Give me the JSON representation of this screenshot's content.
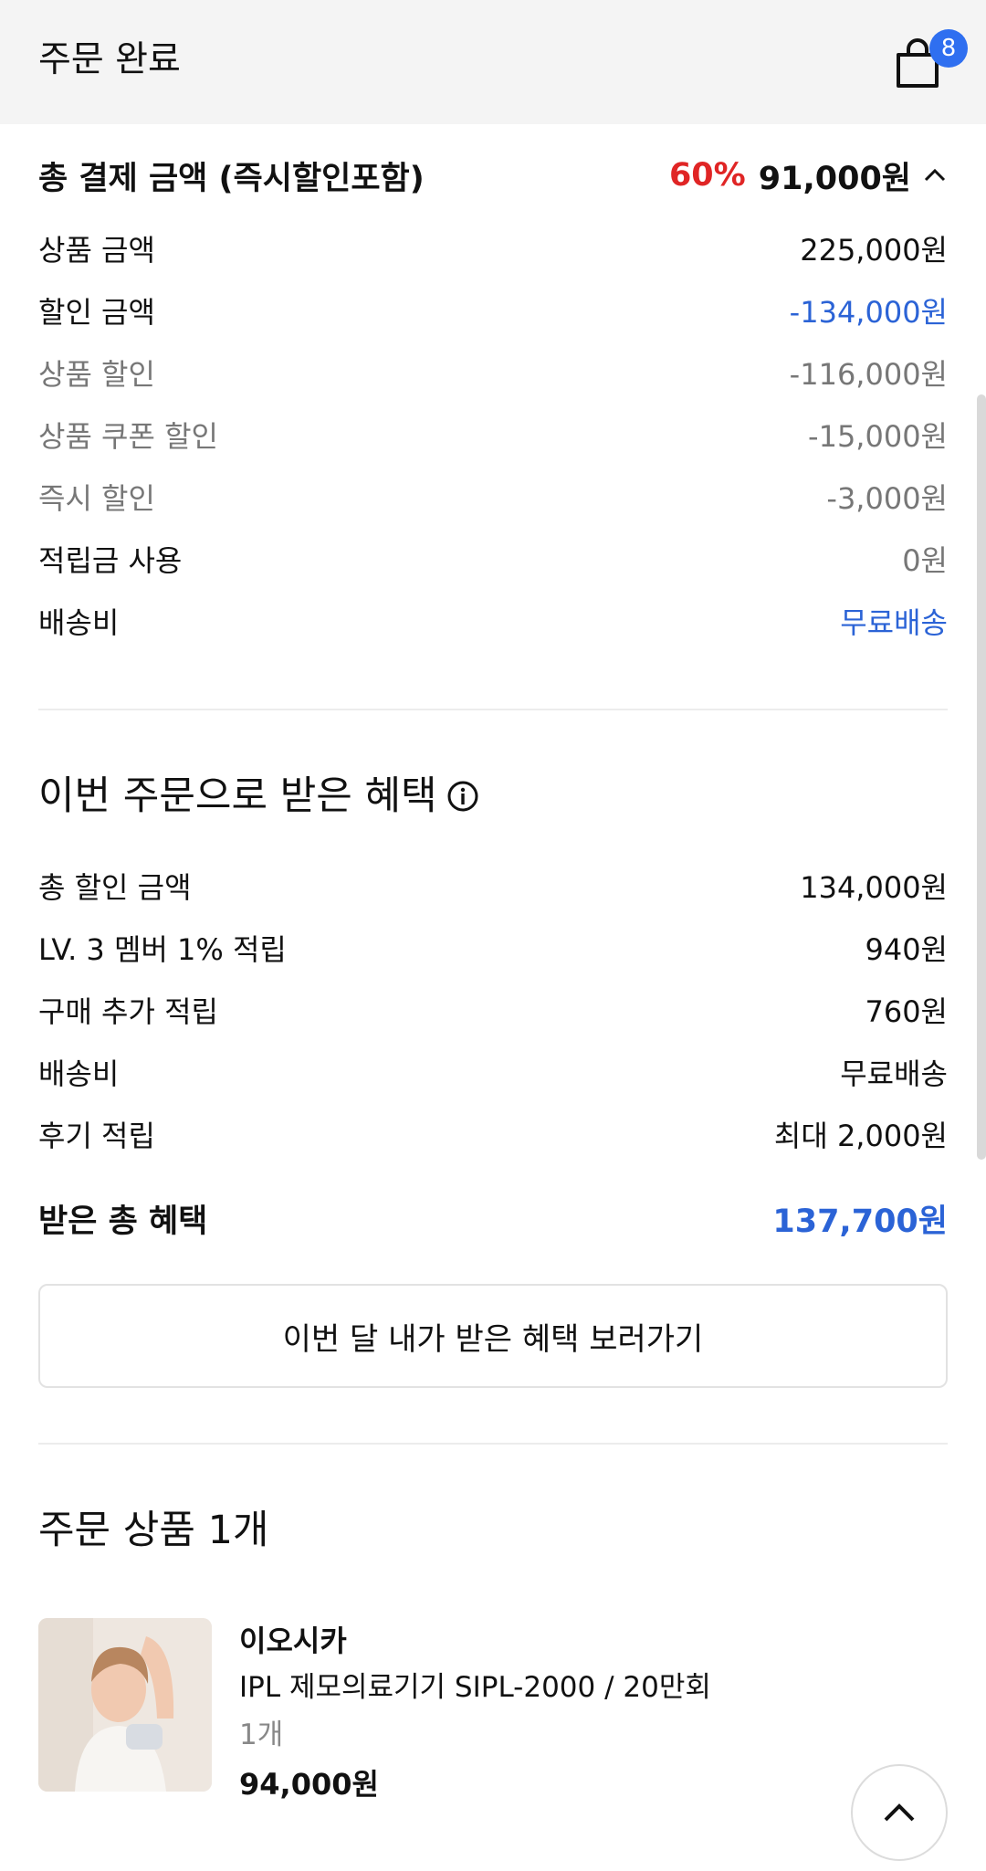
{
  "header": {
    "title": "주문 완료",
    "cart_count": "8",
    "cart_icon": "shopping-bag-icon"
  },
  "payment": {
    "total_label": "총 결제 금액 (즉시할인포함)",
    "discount_rate": "60%",
    "total_amount": "91,000원",
    "rows": [
      {
        "label": "상품 금액",
        "value": "225,000원"
      },
      {
        "label": "할인 금액",
        "value": "-134,000원"
      },
      {
        "label": "상품 할인",
        "value": "-116,000원"
      },
      {
        "label": "상품 쿠폰 할인",
        "value": "-15,000원"
      },
      {
        "label": "즉시 할인",
        "value": "-3,000원"
      },
      {
        "label": "적립금 사용",
        "value": "0원"
      },
      {
        "label": "배송비",
        "value": "무료배송"
      }
    ]
  },
  "benefits": {
    "title": "이번 주문으로 받은 혜택",
    "rows": [
      {
        "label": "총 할인 금액",
        "value": "134,000원"
      },
      {
        "label": "LV. 3 멤버 1% 적립",
        "value": "940원"
      },
      {
        "label": "구매 추가 적립",
        "value": "760원"
      },
      {
        "label": "배송비",
        "value": "무료배송"
      },
      {
        "label": "후기 적립",
        "value": "최대 2,000원"
      }
    ],
    "total_label": "받은 총 혜택",
    "total_value": "137,700원",
    "button_label": "이번 달 내가 받은 혜택 보러가기"
  },
  "order": {
    "title": "주문 상품 1개",
    "product": {
      "brand": "이오시카",
      "name": "IPL 제모의료기기 SIPL-2000 / 20만회",
      "quantity": "1개",
      "price": "94,000원"
    }
  },
  "colors": {
    "accent_blue": "#2b63d6",
    "discount_red": "#e02525",
    "badge_blue": "#2f6ff0"
  }
}
